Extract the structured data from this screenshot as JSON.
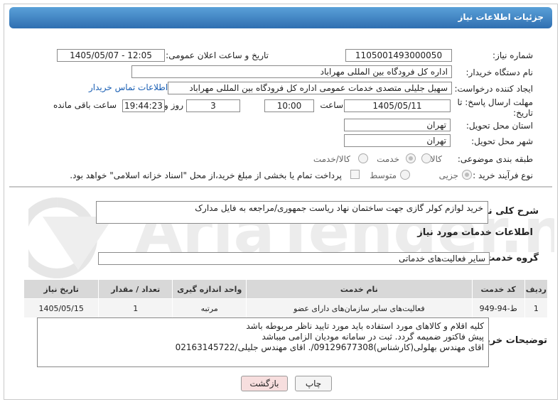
{
  "header": {
    "title": "جزئیات اطلاعات نیاز"
  },
  "form": {
    "need_number": {
      "label": "شماره نیاز:",
      "value": "1105001493000050"
    },
    "announce": {
      "label": "تاریخ و ساعت اعلان عمومی:",
      "value": "1405/05/07 - 12:05"
    },
    "buyer_org": {
      "label": "نام دستگاه خریدار:",
      "value": "اداره کل فرودگاه بین المللی مهراباد"
    },
    "requester": {
      "label": "ایجاد کننده درخواست:",
      "value": "سهیل جلیلی متصدی خدمات عمومی اداره کل فرودگاه بین المللی مهراباد",
      "contact_link": "اطلاعات تماس خریدار"
    },
    "deadline": {
      "label": "مهلت ارسال پاسخ: تا تاریخ:",
      "date": "1405/05/11",
      "time_label": "ساعت",
      "time": "10:00",
      "days": "3",
      "days_label": "روز و",
      "remaining": "19:44:23",
      "remaining_label": "ساعت باقی مانده"
    },
    "province": {
      "label": "استان محل تحویل:",
      "value": "تهران"
    },
    "city": {
      "label": "شهر محل تحویل:",
      "value": "تهران"
    },
    "category": {
      "label": "طبقه بندی موضوعی:",
      "options": [
        "کالا",
        "خدمت",
        "کالا/خدمت"
      ],
      "selected": "خدمت"
    },
    "purchase_type": {
      "label": "نوع فرآیند خرید :",
      "options": [
        "جزیی",
        "متوسط"
      ],
      "selected": "جزیی",
      "payment_note": "پرداخت تمام یا بخشی از مبلغ خرید،از محل \"اسناد خزانه اسلامی\" خواهد بود."
    }
  },
  "description": {
    "label": "شرح کلی نیاز:",
    "value": "خرید لوازم کولر گازی جهت ساختمان نهاد ریاست جمهوری/مراجعه به فایل مدارک"
  },
  "services_section": {
    "title": "اطلاعات خدمات مورد نیاز"
  },
  "service_group": {
    "label": "گروه خدمت:",
    "value": "سایر فعالیت‌های خدماتی"
  },
  "table": {
    "headers": [
      "ردیف",
      "کد خدمت",
      "نام خدمت",
      "واحد اندازه گیری",
      "تعداد / مقدار",
      "تاریخ نیاز"
    ],
    "rows": [
      [
        "1",
        "ط-94-949",
        "فعالیت‌های سایر سازمان‌های دارای عضو",
        "مرتبه",
        "1",
        "1405/05/15"
      ]
    ]
  },
  "buyer_notes": {
    "label": "توضیحات خریدار:",
    "lines": [
      "کلیه اقلام و کالاهای مورد استفاده باید مورد تایید ناظر مربوطه باشد",
      "پیش فاکتور ضمیمه گردد. ثبت در سامانه مودیان الزامی میباشد",
      "اقای مهندس بهلولی(کارشناس)09129677308/. اقای مهندس جلیلی/02163145722"
    ]
  },
  "buttons": {
    "print": "چاپ",
    "back": "بازگشت"
  },
  "watermark": {
    "text": "AriaTender.net"
  },
  "colors": {
    "title_bar": "#3f82c4",
    "link": "#1a5fb4",
    "back_button": "#f7dede"
  }
}
